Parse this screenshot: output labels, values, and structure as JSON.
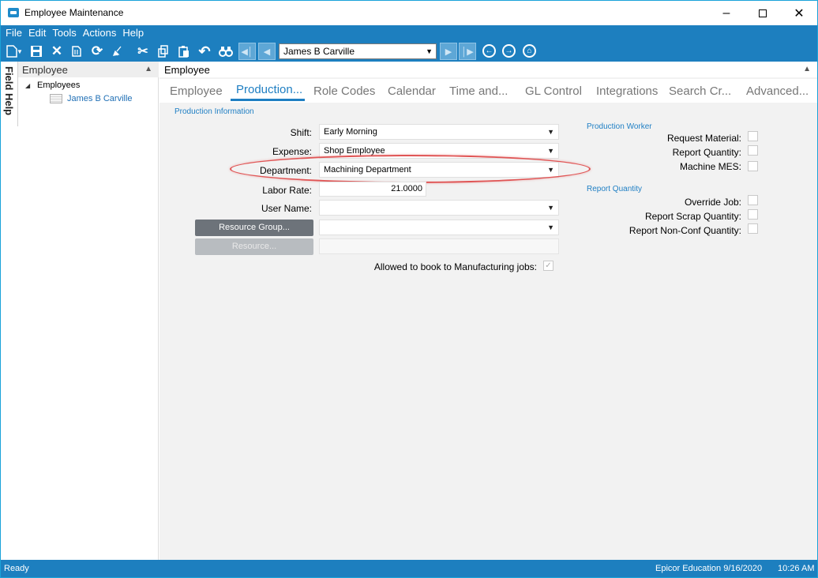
{
  "window": {
    "title": "Employee Maintenance"
  },
  "menu": [
    "File",
    "Edit",
    "Tools",
    "Actions",
    "Help"
  ],
  "toolbar": {
    "record_selector_value": "James B Carville",
    "icons": [
      "new-icon",
      "save-icon",
      "delete-icon",
      "attach-icon",
      "refresh-icon",
      "clear-icon",
      "cut-icon",
      "copy-icon",
      "paste-icon",
      "undo-icon",
      "search-icon",
      "first-record-icon",
      "prev-record-icon",
      "next-record-icon",
      "last-record-icon",
      "back-icon",
      "forward-icon",
      "home-icon"
    ]
  },
  "field_help": {
    "label": "Field Help"
  },
  "tree": {
    "panel_title": "Employee",
    "root_label": "Employees",
    "children": [
      "James B Carville"
    ]
  },
  "main": {
    "panel_title": "Employee",
    "tabs": [
      "Employee",
      "Production...",
      "Role Codes",
      "Calendar",
      "Time and...",
      "GL Control",
      "Integrations",
      "Search Cr...",
      "Advanced..."
    ],
    "active_tab_index": 1
  },
  "production_info": {
    "group_title": "Production Information",
    "shift_label": "Shift:",
    "shift_value": "Early Morning",
    "expense_label": "Expense:",
    "expense_value": "Shop Employee",
    "department_label": "Department:",
    "department_value": "Machining Department",
    "labor_rate_label": "Labor Rate:",
    "labor_rate_value": "21.0000",
    "user_name_label": "User Name:",
    "user_name_value": "",
    "resource_group_button": "Resource Group...",
    "resource_group_value": "",
    "resource_button": "Resource...",
    "resource_value": "",
    "allowed_mfg_label": "Allowed to book to Manufacturing jobs:",
    "allowed_mfg_checked": true
  },
  "production_worker": {
    "group_title": "Production Worker",
    "request_material_label": "Request Material:",
    "report_quantity_label": "Report Quantity:",
    "machine_mes_label": "Machine MES:"
  },
  "report_quantity": {
    "group_title": "Report Quantity",
    "override_job_label": "Override Job:",
    "report_scrap_label": "Report Scrap Quantity:",
    "report_nonconf_label": "Report Non-Conf Quantity:"
  },
  "status": {
    "left": "Ready",
    "company_date": "Epicor Education 9/16/2020",
    "time": "10:26 AM"
  },
  "colors": {
    "accent_blue": "#1d7fbf",
    "tab_active": "#1e7ec2",
    "highlight_red": "#e05555"
  }
}
